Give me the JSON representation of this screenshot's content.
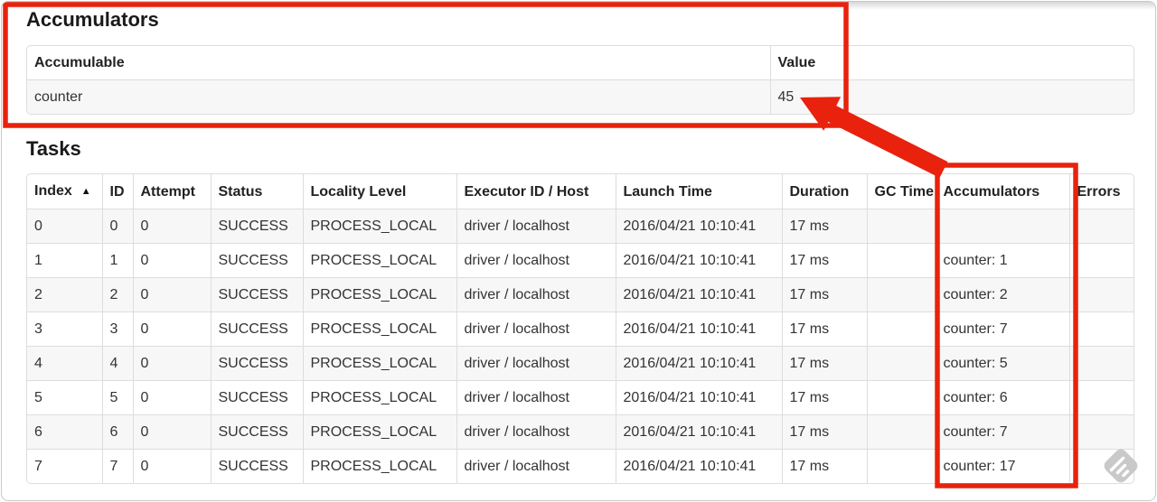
{
  "annotation": {
    "color": "#e8220d"
  },
  "accumulators_section": {
    "heading": "Accumulators",
    "table": {
      "headers": [
        "Accumulable",
        "Value"
      ],
      "rows": [
        {
          "accumulable": "counter",
          "value": "45"
        }
      ]
    }
  },
  "tasks_section": {
    "heading": "Tasks",
    "table": {
      "headers": [
        "Index",
        "ID",
        "Attempt",
        "Status",
        "Locality Level",
        "Executor ID / Host",
        "Launch Time",
        "Duration",
        "GC Time",
        "Accumulators",
        "Errors"
      ],
      "sort_column": "Index",
      "sort_indicator": "▲",
      "rows": [
        [
          "0",
          "0",
          "0",
          "SUCCESS",
          "PROCESS_LOCAL",
          "driver / localhost",
          "2016/04/21 10:10:41",
          "17 ms",
          "",
          "",
          ""
        ],
        [
          "1",
          "1",
          "0",
          "SUCCESS",
          "PROCESS_LOCAL",
          "driver / localhost",
          "2016/04/21 10:10:41",
          "17 ms",
          "",
          "counter: 1",
          ""
        ],
        [
          "2",
          "2",
          "0",
          "SUCCESS",
          "PROCESS_LOCAL",
          "driver / localhost",
          "2016/04/21 10:10:41",
          "17 ms",
          "",
          "counter: 2",
          ""
        ],
        [
          "3",
          "3",
          "0",
          "SUCCESS",
          "PROCESS_LOCAL",
          "driver / localhost",
          "2016/04/21 10:10:41",
          "17 ms",
          "",
          "counter: 7",
          ""
        ],
        [
          "4",
          "4",
          "0",
          "SUCCESS",
          "PROCESS_LOCAL",
          "driver / localhost",
          "2016/04/21 10:10:41",
          "17 ms",
          "",
          "counter: 5",
          ""
        ],
        [
          "5",
          "5",
          "0",
          "SUCCESS",
          "PROCESS_LOCAL",
          "driver / localhost",
          "2016/04/21 10:10:41",
          "17 ms",
          "",
          "counter: 6",
          ""
        ],
        [
          "6",
          "6",
          "0",
          "SUCCESS",
          "PROCESS_LOCAL",
          "driver / localhost",
          "2016/04/21 10:10:41",
          "17 ms",
          "",
          "counter: 7",
          ""
        ],
        [
          "7",
          "7",
          "0",
          "SUCCESS",
          "PROCESS_LOCAL",
          "driver / localhost",
          "2016/04/21 10:10:41",
          "17 ms",
          "",
          "counter: 17",
          ""
        ]
      ]
    }
  },
  "watermark": {
    "name": "feedly-logo",
    "color": "#c9c9c9"
  }
}
